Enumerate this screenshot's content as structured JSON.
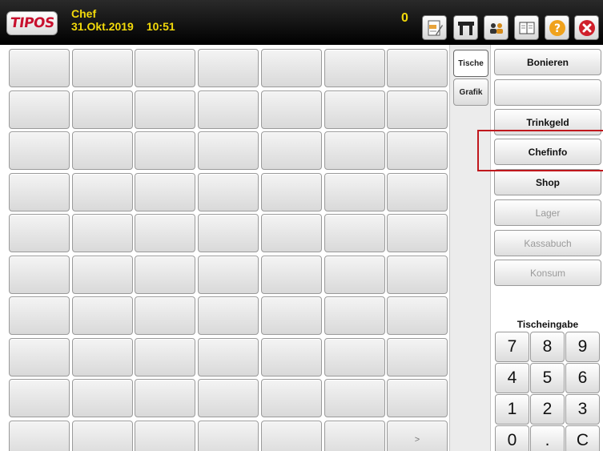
{
  "header": {
    "logo_text": "TIPOS",
    "user": "Chef",
    "date": "31.Okt.2019",
    "time": "10:51",
    "counter": "0"
  },
  "icons": [
    "notes-icon",
    "table-icon",
    "users-icon",
    "book-icon",
    "help-icon",
    "close-icon"
  ],
  "tabs": [
    {
      "label": "Tische",
      "active": true
    },
    {
      "label": "Grafik",
      "active": false
    }
  ],
  "grid": {
    "rows": 10,
    "cols": 7,
    "last_cell_label": ">"
  },
  "side_buttons": [
    {
      "label": "Bonieren",
      "enabled": true
    },
    {
      "label": "",
      "enabled": true
    },
    {
      "label": "Trinkgeld",
      "enabled": true
    },
    {
      "label": "Chefinfo",
      "enabled": true
    },
    {
      "label": "Shop",
      "enabled": true
    },
    {
      "label": "Lager",
      "enabled": false
    },
    {
      "label": "Kassabuch",
      "enabled": false
    },
    {
      "label": "Konsum",
      "enabled": false
    }
  ],
  "keypad": {
    "title": "Tischeingabe",
    "keys": [
      "7",
      "8",
      "9",
      "4",
      "5",
      "6",
      "1",
      "2",
      "3",
      "0",
      ".",
      "C"
    ]
  },
  "colors": {
    "header_text": "#f2d90a",
    "highlight": "#c0181d",
    "logo_red": "#c8102e"
  }
}
